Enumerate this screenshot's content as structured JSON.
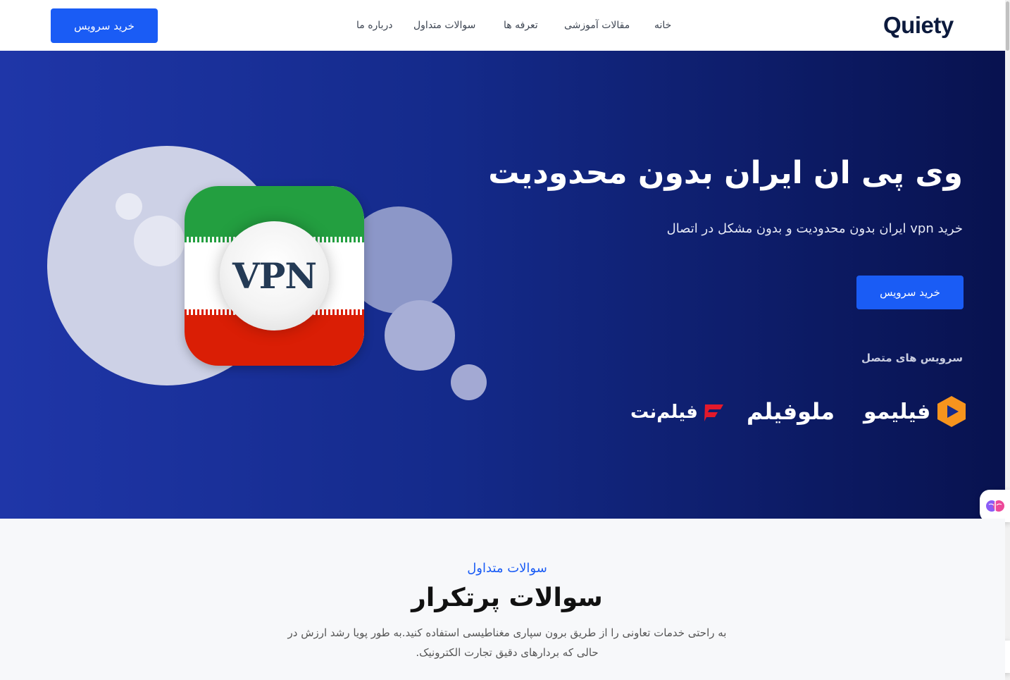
{
  "header": {
    "logo": "Quiety",
    "nav": [
      "خانه",
      "مقالات آموزشی",
      "تعرفه ها",
      "سوالات متداول",
      "درباره ما"
    ],
    "buy_button": "خرید سرویس"
  },
  "hero": {
    "icon_text": "VPN",
    "title": "وی پی ان ایران بدون محدودیت",
    "subtitle": "خرید vpn ایران بدون محدودیت و بدون مشکل در اتصال",
    "buy_button": "خرید سرویس",
    "services_label": "سرویس های متصل",
    "services": [
      "فیلیمو",
      "ملوفیلم",
      "فیلم‌نت"
    ]
  },
  "faq": {
    "kicker": "سوالات متداول",
    "title": "سوالات پرتکرار",
    "description": "به راحتی خدمات تعاونی را از طریق برون سپاری مغناطیسی استفاده کنید.به طور پویا رشد ارزش در حالی که بردارهای دقیق تجارت الکترونیک."
  },
  "colors": {
    "accent": "#1a5cf5",
    "hero_dark": "#08124f",
    "hero_light": "#1f36a8"
  }
}
